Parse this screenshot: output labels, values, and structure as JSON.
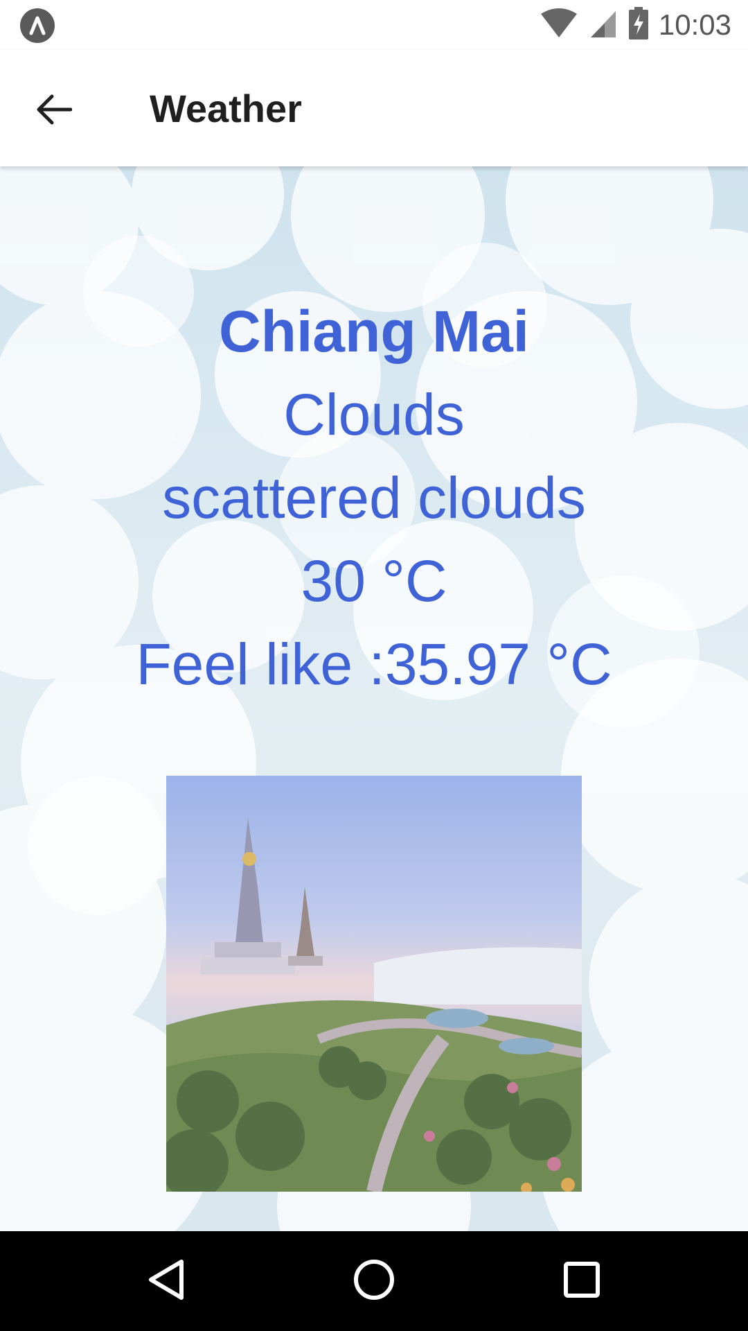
{
  "status_bar": {
    "time": "10:03",
    "app_icon": "autodesk-logo-icon",
    "icons": [
      "wifi-icon",
      "cell-signal-icon",
      "battery-charging-icon"
    ]
  },
  "app_bar": {
    "title": "Weather",
    "back_icon": "arrow-left-icon"
  },
  "weather": {
    "city": "Chiang Mai",
    "condition": "Clouds",
    "description": "scattered clouds",
    "temperature": "30 °C",
    "feels_like": "Feel like :35.97 °C"
  },
  "image": {
    "subject": "chiang-mai-landscape-photo"
  },
  "nav_bar": {
    "icons": [
      "nav-back-icon",
      "nav-home-icon",
      "nav-recents-icon"
    ]
  },
  "colors": {
    "accent": "#3f63d6",
    "nav_bar": "#000000",
    "app_bar": "#ffffff"
  }
}
